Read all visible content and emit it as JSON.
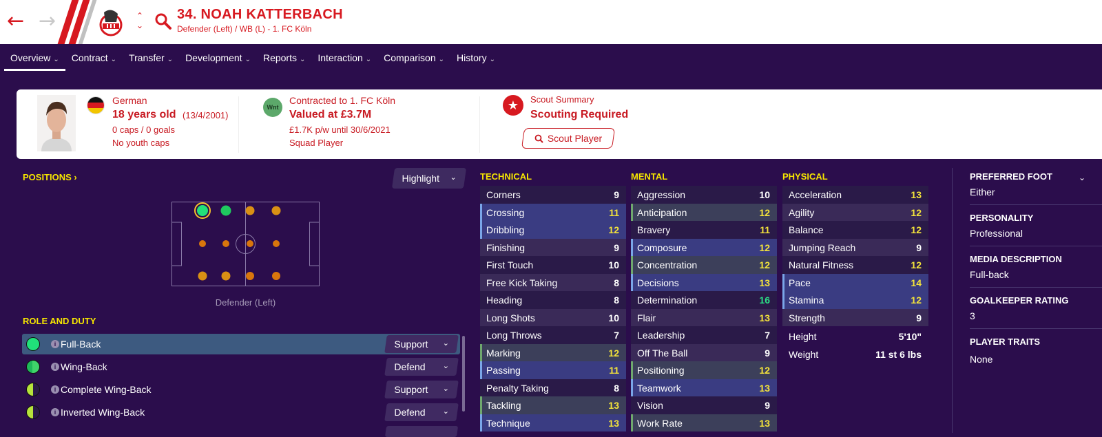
{
  "header": {
    "player_name": "34. NOAH KATTERBACH",
    "subtitle": "Defender (Left) / WB (L) - 1. FC Köln"
  },
  "tabs": [
    {
      "label": "Overview"
    },
    {
      "label": "Contract"
    },
    {
      "label": "Transfer"
    },
    {
      "label": "Development"
    },
    {
      "label": "Reports"
    },
    {
      "label": "Interaction"
    },
    {
      "label": "Comparison"
    },
    {
      "label": "History"
    }
  ],
  "profile": {
    "nationality": "German",
    "age": "18 years old",
    "dob": "(13/4/2001)",
    "caps": "0 caps / 0 goals",
    "youth_caps": "No youth caps",
    "club_badge": "Wnt",
    "contracted": "Contracted to 1. FC Köln",
    "value": "Valued at £3.7M",
    "wage": "£1.7K p/w until 30/6/2021",
    "status": "Squad Player",
    "scout_label": "Scout Summary",
    "scout_status": "Scouting Required",
    "scout_button": "Scout Player"
  },
  "positions": {
    "title": "POSITIONS",
    "highlight_label": "Highlight",
    "caption": "Defender (Left)"
  },
  "roles": {
    "title": "ROLE AND DUTY",
    "items": [
      {
        "name": "Full-Back",
        "duty": "Support",
        "color": "#20e07a"
      },
      {
        "name": "Wing-Back",
        "duty": "Defend",
        "color": "#3fd46a"
      },
      {
        "name": "Complete Wing-Back",
        "duty": "Support",
        "color": "#b6e33b"
      },
      {
        "name": "Inverted Wing-Back",
        "duty": "Defend",
        "color": "#b6e33b"
      }
    ]
  },
  "technical": {
    "title": "TECHNICAL",
    "items": [
      {
        "name": "Corners",
        "value": "9"
      },
      {
        "name": "Crossing",
        "value": "11"
      },
      {
        "name": "Dribbling",
        "value": "12"
      },
      {
        "name": "Finishing",
        "value": "9"
      },
      {
        "name": "First Touch",
        "value": "10"
      },
      {
        "name": "Free Kick Taking",
        "value": "8"
      },
      {
        "name": "Heading",
        "value": "8"
      },
      {
        "name": "Long Shots",
        "value": "10"
      },
      {
        "name": "Long Throws",
        "value": "7"
      },
      {
        "name": "Marking",
        "value": "12"
      },
      {
        "name": "Passing",
        "value": "11"
      },
      {
        "name": "Penalty Taking",
        "value": "8"
      },
      {
        "name": "Tackling",
        "value": "13"
      },
      {
        "name": "Technique",
        "value": "13"
      }
    ]
  },
  "mental": {
    "title": "MENTAL",
    "items": [
      {
        "name": "Aggression",
        "value": "10"
      },
      {
        "name": "Anticipation",
        "value": "12"
      },
      {
        "name": "Bravery",
        "value": "11"
      },
      {
        "name": "Composure",
        "value": "12"
      },
      {
        "name": "Concentration",
        "value": "12"
      },
      {
        "name": "Decisions",
        "value": "13"
      },
      {
        "name": "Determination",
        "value": "16"
      },
      {
        "name": "Flair",
        "value": "13"
      },
      {
        "name": "Leadership",
        "value": "7"
      },
      {
        "name": "Off The Ball",
        "value": "9"
      },
      {
        "name": "Positioning",
        "value": "12"
      },
      {
        "name": "Teamwork",
        "value": "13"
      },
      {
        "name": "Vision",
        "value": "9"
      },
      {
        "name": "Work Rate",
        "value": "13"
      }
    ]
  },
  "physical": {
    "title": "PHYSICAL",
    "items": [
      {
        "name": "Acceleration",
        "value": "13"
      },
      {
        "name": "Agility",
        "value": "12"
      },
      {
        "name": "Balance",
        "value": "12"
      },
      {
        "name": "Jumping Reach",
        "value": "9"
      },
      {
        "name": "Natural Fitness",
        "value": "12"
      },
      {
        "name": "Pace",
        "value": "14"
      },
      {
        "name": "Stamina",
        "value": "12"
      },
      {
        "name": "Strength",
        "value": "9"
      }
    ],
    "height_label": "Height",
    "height": "5'10\"",
    "weight_label": "Weight",
    "weight": "11 st 6 lbs"
  },
  "info": {
    "preferred_foot_label": "PREFERRED FOOT",
    "preferred_foot": "Either",
    "personality_label": "PERSONALITY",
    "personality": "Professional",
    "media_label": "MEDIA DESCRIPTION",
    "media": "Full-back",
    "gk_label": "GOALKEEPER RATING",
    "gk": "3",
    "traits_label": "PLAYER TRAITS",
    "traits": "None"
  },
  "colors": {
    "accent": "#d71920",
    "background": "#2b0d4c",
    "attr_yellow": "#f3e33b",
    "attr_green": "#2bdf86"
  }
}
